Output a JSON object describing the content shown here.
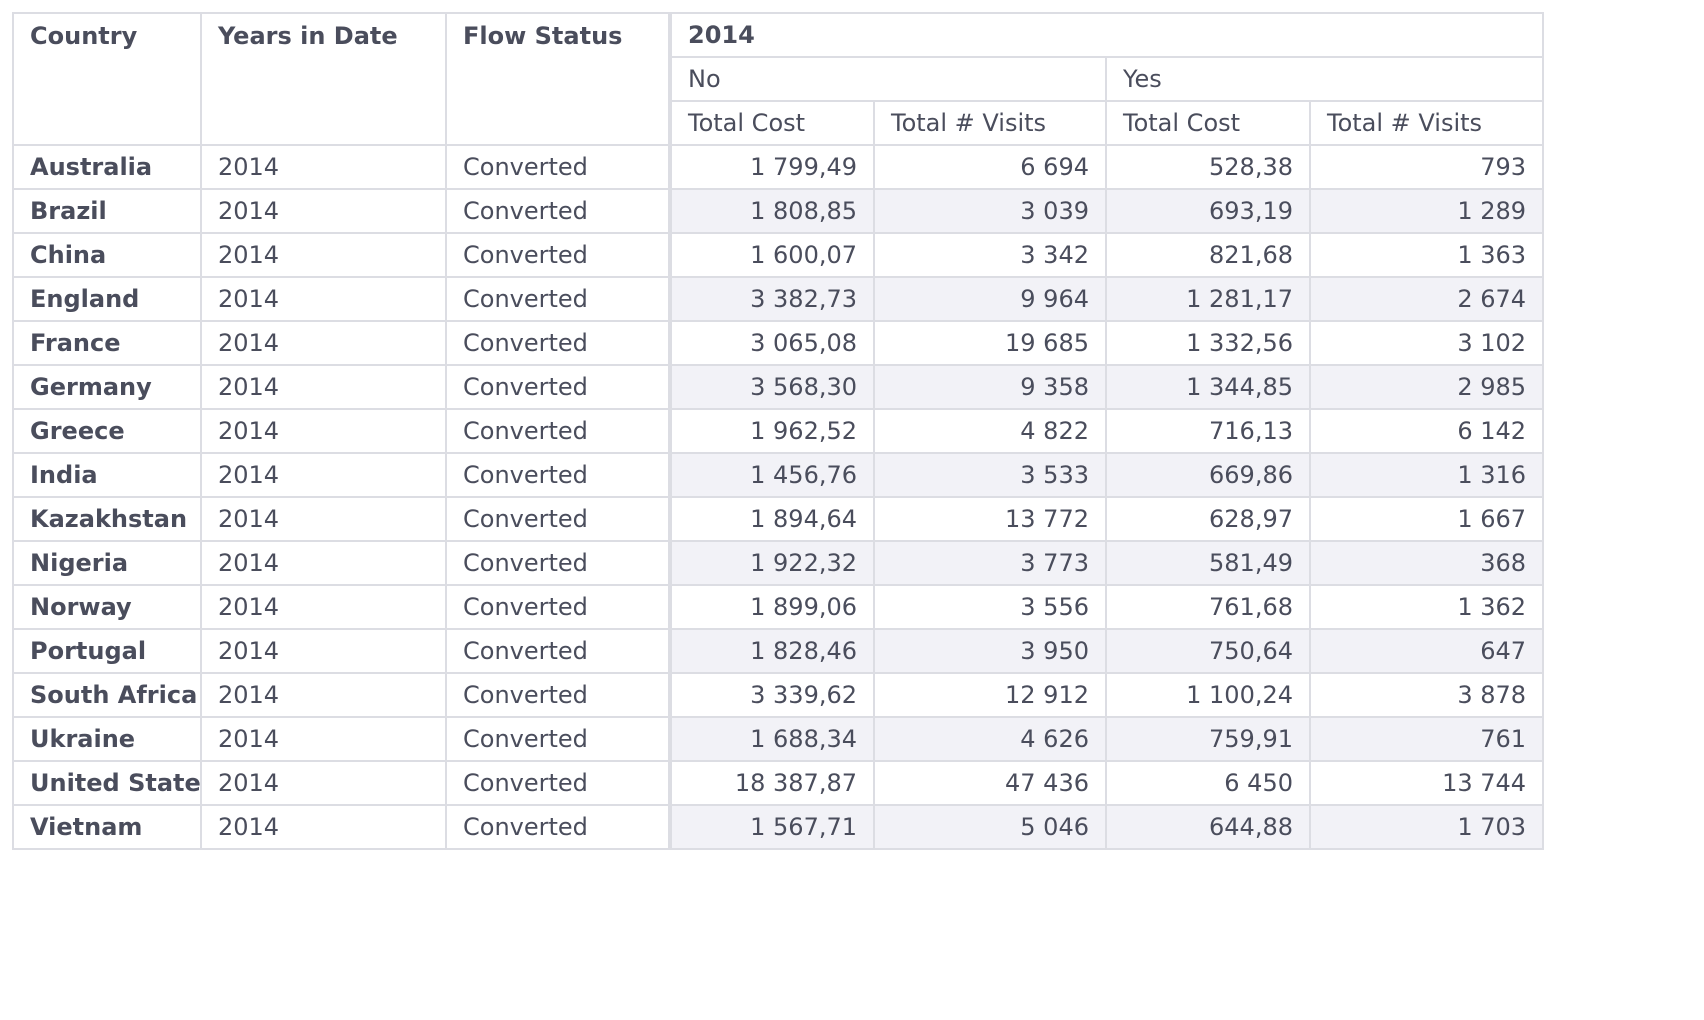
{
  "headers": {
    "country": "Country",
    "years": "Years in Date",
    "flow_status": "Flow Status",
    "year_group": "2014",
    "no": "No",
    "yes": "Yes",
    "no_total_cost": "Total Cost",
    "no_total_visits": "Total # Visits",
    "yes_total_cost": "Total Cost",
    "yes_total_visits": "Total # Visits"
  },
  "rows": [
    {
      "country": "Australia",
      "year": "2014",
      "status": "Converted",
      "no_cost": "1 799,49",
      "no_visits": "6 694",
      "yes_cost": "528,38",
      "yes_visits": "793"
    },
    {
      "country": "Brazil",
      "year": "2014",
      "status": "Converted",
      "no_cost": "1 808,85",
      "no_visits": "3 039",
      "yes_cost": "693,19",
      "yes_visits": "1 289"
    },
    {
      "country": "China",
      "year": "2014",
      "status": "Converted",
      "no_cost": "1 600,07",
      "no_visits": "3 342",
      "yes_cost": "821,68",
      "yes_visits": "1 363"
    },
    {
      "country": "England",
      "year": "2014",
      "status": "Converted",
      "no_cost": "3 382,73",
      "no_visits": "9 964",
      "yes_cost": "1 281,17",
      "yes_visits": "2 674"
    },
    {
      "country": "France",
      "year": "2014",
      "status": "Converted",
      "no_cost": "3 065,08",
      "no_visits": "19 685",
      "yes_cost": "1 332,56",
      "yes_visits": "3 102"
    },
    {
      "country": "Germany",
      "year": "2014",
      "status": "Converted",
      "no_cost": "3 568,30",
      "no_visits": "9 358",
      "yes_cost": "1 344,85",
      "yes_visits": "2 985"
    },
    {
      "country": "Greece",
      "year": "2014",
      "status": "Converted",
      "no_cost": "1 962,52",
      "no_visits": "4 822",
      "yes_cost": "716,13",
      "yes_visits": "6 142"
    },
    {
      "country": "India",
      "year": "2014",
      "status": "Converted",
      "no_cost": "1 456,76",
      "no_visits": "3 533",
      "yes_cost": "669,86",
      "yes_visits": "1 316"
    },
    {
      "country": "Kazakhstan",
      "year": "2014",
      "status": "Converted",
      "no_cost": "1 894,64",
      "no_visits": "13 772",
      "yes_cost": "628,97",
      "yes_visits": "1 667"
    },
    {
      "country": "Nigeria",
      "year": "2014",
      "status": "Converted",
      "no_cost": "1 922,32",
      "no_visits": "3 773",
      "yes_cost": "581,49",
      "yes_visits": "368"
    },
    {
      "country": "Norway",
      "year": "2014",
      "status": "Converted",
      "no_cost": "1 899,06",
      "no_visits": "3 556",
      "yes_cost": "761,68",
      "yes_visits": "1 362"
    },
    {
      "country": "Portugal",
      "year": "2014",
      "status": "Converted",
      "no_cost": "1 828,46",
      "no_visits": "3 950",
      "yes_cost": "750,64",
      "yes_visits": "647"
    },
    {
      "country": "South Africa",
      "year": "2014",
      "status": "Converted",
      "no_cost": "3 339,62",
      "no_visits": "12 912",
      "yes_cost": "1 100,24",
      "yes_visits": "3 878"
    },
    {
      "country": "Ukraine",
      "year": "2014",
      "status": "Converted",
      "no_cost": "1 688,34",
      "no_visits": "4 626",
      "yes_cost": "759,91",
      "yes_visits": "761"
    },
    {
      "country": "United States",
      "year": "2014",
      "status": "Converted",
      "no_cost": "18 387,87",
      "no_visits": "47 436",
      "yes_cost": "6 450",
      "yes_visits": "13 744"
    },
    {
      "country": "Vietnam",
      "year": "2014",
      "status": "Converted",
      "no_cost": "1 567,71",
      "no_visits": "5 046",
      "yes_cost": "644,88",
      "yes_visits": "1 703"
    }
  ],
  "colors": {
    "border": "#dcdde3",
    "text": "#4a4d5c",
    "alt_row": "#f2f2f7"
  }
}
